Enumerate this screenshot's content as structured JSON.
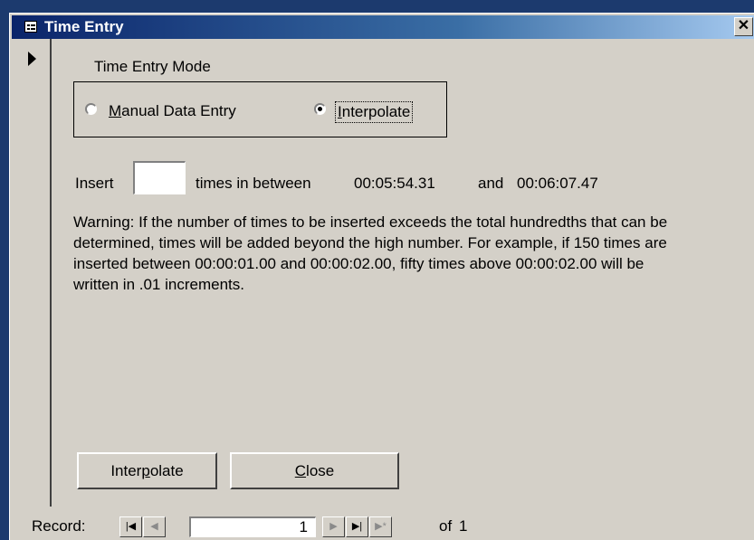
{
  "window": {
    "title": "Time Entry",
    "close_glyph": "✕"
  },
  "mode_group": {
    "label": "Time Entry Mode",
    "options": [
      {
        "mnemonic": "M",
        "rest": "anual Data Entry",
        "selected": false
      },
      {
        "mnemonic": "I",
        "rest": "nterpolate",
        "selected": true
      }
    ]
  },
  "insert_row": {
    "prefix": "Insert",
    "value": "",
    "middle": "times in between",
    "start_time": "00:05:54.31",
    "conjunction": "and",
    "end_time": "00:06:07.47"
  },
  "warning": "Warning: If the number of times to be inserted exceeds the total hundredths that can be determined, times will be added beyond the high number. For example, if 150 times are inserted between 00:00:01.00 and 00:00:02.00, fifty times above 00:00:02.00 will be written in .01 increments.",
  "buttons": {
    "interpolate": {
      "pre": "Inter",
      "mnemonic": "p",
      "post": "olate"
    },
    "close": {
      "pre": "",
      "mnemonic": "C",
      "post": "lose"
    }
  },
  "record_nav": {
    "label": "Record:",
    "first_glyph": "|◀",
    "prev_glyph": "◀",
    "current": "1",
    "next_glyph": "▶",
    "last_glyph": "▶|",
    "new_glyph": "▶*",
    "of_label": "of",
    "total": "1"
  }
}
